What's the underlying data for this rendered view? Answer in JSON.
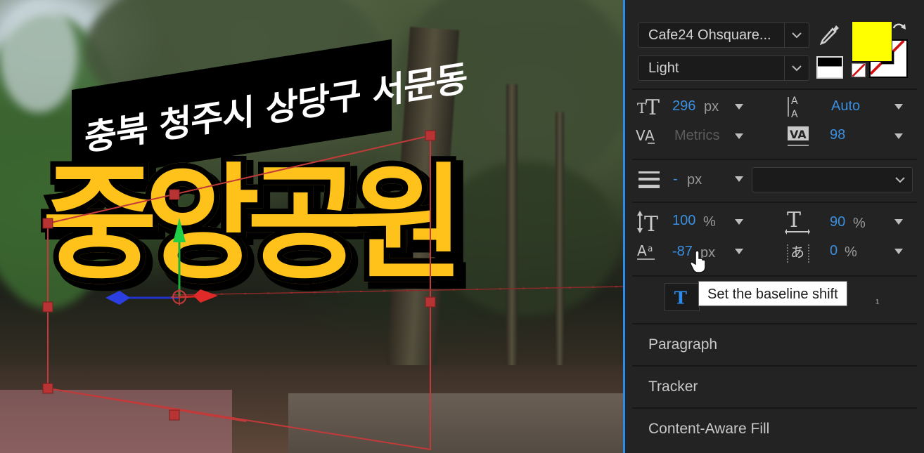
{
  "viewer": {
    "banner_text": "충북 청주시 상당구 서문동",
    "park_name": "중앙공원"
  },
  "character": {
    "font_family": "Cafe24 Ohsquare...",
    "font_style": "Light",
    "fill_color": "#ffff00",
    "stroke_color": "none",
    "font_size": {
      "value": "296",
      "unit": "px"
    },
    "leading": {
      "value": "Auto"
    },
    "kerning": {
      "value": "Metrics"
    },
    "tracking": {
      "value": "98"
    },
    "stroke_width": {
      "value": "-",
      "unit": "px"
    },
    "stroke_option": "",
    "vertical_scale": {
      "value": "100",
      "unit": "%"
    },
    "horizontal_scale": {
      "value": "90",
      "unit": "%"
    },
    "baseline_shift": {
      "value": "-87",
      "unit": "px"
    },
    "tsume": {
      "value": "0",
      "unit": "%"
    }
  },
  "tooltip": "Set the baseline shift",
  "sections": {
    "paragraph": "Paragraph",
    "tracker": "Tracker",
    "content_aware_fill": "Content-Aware Fill"
  },
  "colors": {
    "accent": "#2d8ceb",
    "value_blue": "#3b8fe0",
    "panel_bg": "#232323"
  }
}
